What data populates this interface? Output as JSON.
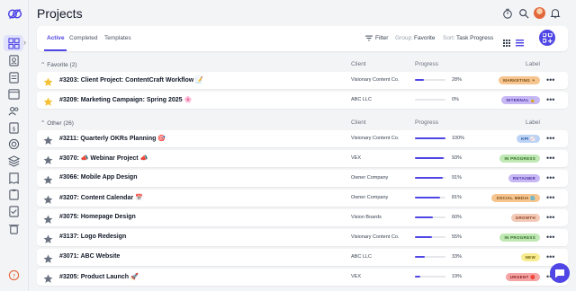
{
  "page": {
    "title": "Projects"
  },
  "sidebar": {
    "items": [
      "home-grid-icon",
      "contacts-icon",
      "document-icon",
      "calendar-icon",
      "users-icon",
      "invoice-icon",
      "target-icon",
      "layers-icon",
      "receipt-icon",
      "clipboard-icon",
      "checklist-icon",
      "trash-icon",
      "help-icon"
    ]
  },
  "header": {
    "icons": [
      "timer-icon",
      "search-icon",
      "avatar",
      "bell-icon"
    ]
  },
  "toolbar": {
    "tabs": [
      "Active",
      "Completed",
      "Templates"
    ],
    "filter_label": "Filter",
    "group_label": "Group:",
    "group_value": "Favorite",
    "sort_label": "Sort:",
    "sort_value": "Task Progress"
  },
  "sections": [
    {
      "title": "Favorite (2)",
      "client_col": "Client",
      "progress_col": "Progress",
      "label_col": "Label"
    },
    {
      "title": "Other (26)",
      "client_col": "Client",
      "progress_col": "Progress",
      "label_col": "Label"
    }
  ],
  "favorite_rows": [
    {
      "name": "#3203: Client Project: ContentCraft Workflow 📝",
      "client": "Visionary Content Co.",
      "progress": 28,
      "pct_text": "28%",
      "label": "MARKETING ☀",
      "label_bg": "#f6c48e",
      "label_fg": "#7a4a12",
      "starred": true
    },
    {
      "name": "#3209: Marketing Campaign: Spring 2025 🌸",
      "client": "ABC LLC",
      "progress": 0,
      "pct_text": "0%",
      "label": "INTERNAL 🔒",
      "label_bg": "#c7b8f5",
      "label_fg": "#4b2ea0",
      "starred": true
    }
  ],
  "other_rows": [
    {
      "name": "#3211: Quarterly OKRs Planning 🎯",
      "client": "Visionary Content Co.",
      "progress": 100,
      "pct_text": "100%",
      "label": "KPI 📈",
      "label_bg": "#bcd3f5",
      "label_fg": "#1f4f99",
      "starred": false
    },
    {
      "name": "#3070: 📣 Webinar Project 📣",
      "client": "VEX",
      "progress": 93,
      "pct_text": "93%",
      "label": "IN PROGRESS",
      "label_bg": "#bfe8b5",
      "label_fg": "#2f6b22",
      "starred": false
    },
    {
      "name": "#3066: Mobile App Design",
      "client": "Owner Company",
      "progress": 91,
      "pct_text": "91%",
      "label": "RETAINER",
      "label_bg": "#c7b8f5",
      "label_fg": "#4b2ea0",
      "starred": false
    },
    {
      "name": "#3207: Content Calendar 📅",
      "client": "Owner Company",
      "progress": 81,
      "pct_text": "81%",
      "label": "SOCIAL MEDIA 🌐",
      "label_bg": "#f6c48e",
      "label_fg": "#7a4a12",
      "starred": false
    },
    {
      "name": "#3075: Homepage Design",
      "client": "Vision Boards",
      "progress": 60,
      "pct_text": "60%",
      "label": "GROWTH",
      "label_bg": "#f3c9b6",
      "label_fg": "#8a3d1c",
      "starred": false
    },
    {
      "name": "#3137: Logo Redesign",
      "client": "Visionary Content Co.",
      "progress": 55,
      "pct_text": "55%",
      "label": "IN PROGRESS",
      "label_bg": "#bfe8b5",
      "label_fg": "#2f6b22",
      "starred": false
    },
    {
      "name": "#3071: ABC Website",
      "client": "ABC LLC",
      "progress": 33,
      "pct_text": "33%",
      "label": "NEW",
      "label_bg": "#f7ec8f",
      "label_fg": "#6b5b0a",
      "starred": false
    },
    {
      "name": "#3205: Product Launch 🚀",
      "client": "VEX",
      "progress": 19,
      "pct_text": "19%",
      "label": "URGENT 🔴",
      "label_bg": "#f5a3a3",
      "label_fg": "#8a1c1c",
      "starred": false
    }
  ],
  "colors": {
    "accent": "#4f46e5",
    "star_gold": "#f5c033",
    "star_gray": "#6b7280"
  }
}
